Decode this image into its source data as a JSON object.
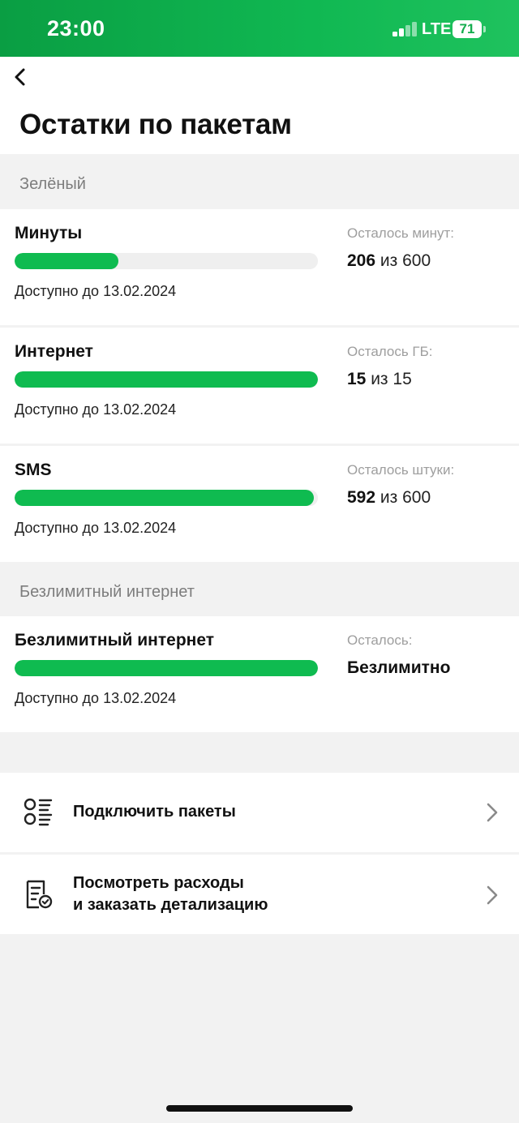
{
  "status": {
    "time": "23:00",
    "network": "LTE",
    "battery": "71"
  },
  "header": {
    "title": "Остатки по пакетам"
  },
  "sections": [
    {
      "title": "Зелёный"
    },
    {
      "title": "Безлимитный интернет"
    }
  ],
  "packages": [
    {
      "name": "Минуты",
      "remaining_label": "Осталось минут:",
      "remaining": "206",
      "of_text": "из 600",
      "fraction": 0.343,
      "available_until": "Доступно до 13.02.2024"
    },
    {
      "name": "Интернет",
      "remaining_label": "Осталось ГБ:",
      "remaining": "15",
      "of_text": "из 15",
      "fraction": 1.0,
      "available_until": "Доступно до 13.02.2024"
    },
    {
      "name": "SMS",
      "remaining_label": "Осталось штуки:",
      "remaining": "592",
      "of_text": "из 600",
      "fraction": 0.987,
      "available_until": "Доступно до 13.02.2024"
    },
    {
      "name": "Безлимитный интернет",
      "remaining_label": "Осталось:",
      "remaining": "Безлимитно",
      "of_text": "",
      "fraction": 1.0,
      "available_until": "Доступно до 13.02.2024"
    }
  ],
  "actions": [
    {
      "label_line1": "Подключить пакеты",
      "label_line2": "",
      "icon": "list-options-icon"
    },
    {
      "label_line1": "Посмотреть расходы",
      "label_line2": "и заказать детализацию",
      "icon": "receipt-check-icon"
    }
  ],
  "colors": {
    "accent": "#0fbb50",
    "track": "#efefef",
    "muted": "#9e9e9e"
  }
}
